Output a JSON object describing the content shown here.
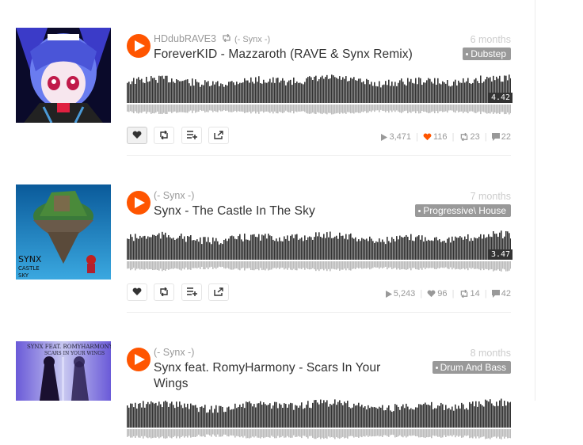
{
  "tracks": [
    {
      "uploader": "HDdubRAVE3",
      "reposter": "(- Synx -)",
      "title": "ForeverKID - Mazzaroth (RAVE & Synx Remix)",
      "time_ago": "6 months",
      "tag": "Dubstep",
      "duration": "4.42",
      "plays": "3,471",
      "likes": "116",
      "reposts": "23",
      "comments": "22",
      "liked": true,
      "art_caption": ""
    },
    {
      "uploader": "",
      "reposter": "(- Synx -)",
      "title": "Synx - The Castle In The Sky",
      "time_ago": "7 months",
      "tag": "Progressive\\ House",
      "duration": "3.47",
      "plays": "5,243",
      "likes": "96",
      "reposts": "14",
      "comments": "42",
      "liked": false,
      "art_caption": "SYNX THE CASTLE IN THE SKY"
    },
    {
      "uploader": "",
      "reposter": "(- Synx -)",
      "title_line1": "Synx feat. RomyHarmony - Scars In Your",
      "title_line2": "Wings",
      "time_ago": "8 months",
      "tag": "Drum And Bass",
      "art_caption": "SYNX FEAT. ROMYHARMONY SCARS IN YOUR WINGS"
    }
  ],
  "colors": {
    "accent": "#ff5500",
    "wave": "#333333",
    "tag_bg": "#999999"
  },
  "icons": {
    "play": "play-icon",
    "like": "heart-icon",
    "repost": "repost-icon",
    "playlist": "add-to-playlist-icon",
    "share": "share-icon"
  }
}
